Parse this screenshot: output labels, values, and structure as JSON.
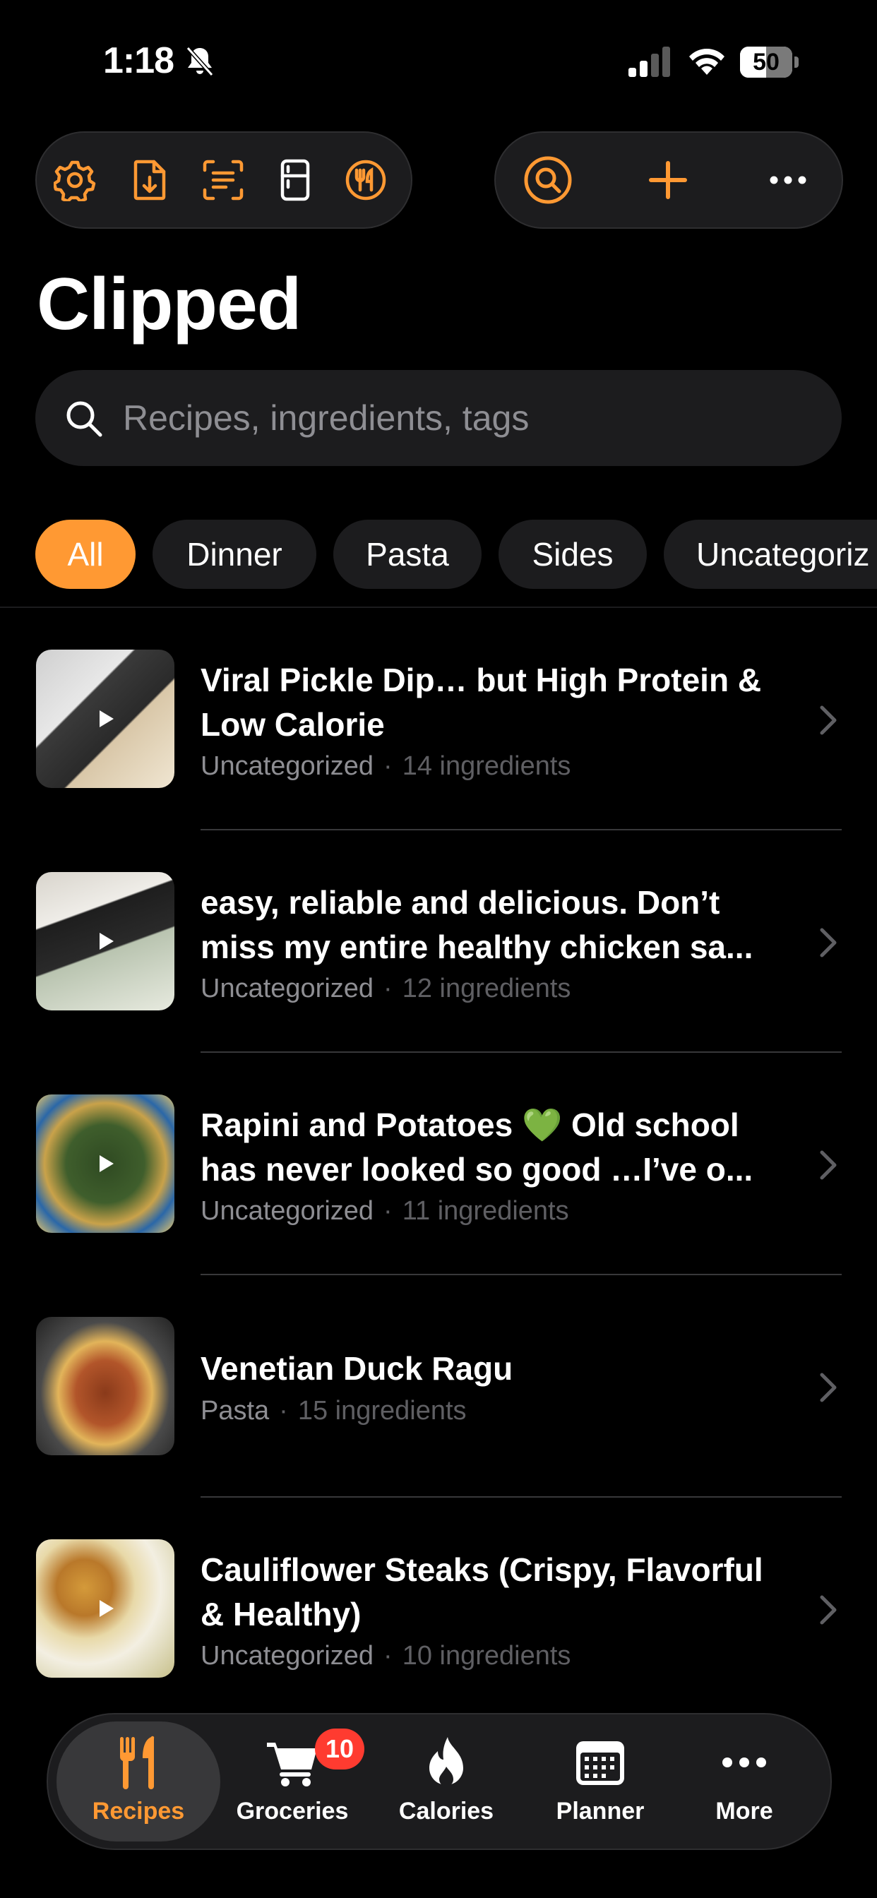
{
  "status_bar": {
    "time": "1:18",
    "battery": "50",
    "battery_level": 0.5,
    "icons": [
      "bell-slash-icon",
      "cellular-signal-icon",
      "wifi-icon",
      "battery-icon"
    ]
  },
  "toolbar_left": [
    "gear-icon",
    "document-download-icon",
    "scan-text-icon",
    "fridge-icon",
    "fork-knife-circle-icon"
  ],
  "toolbar_right": [
    "search-circle-icon",
    "plus-icon",
    "ellipsis-icon"
  ],
  "accent_color": "#ff9933",
  "page_title": "Clipped",
  "search": {
    "placeholder": "Recipes, ingredients, tags"
  },
  "filters": [
    {
      "label": "All",
      "active": true
    },
    {
      "label": "Dinner",
      "active": false
    },
    {
      "label": "Pasta",
      "active": false
    },
    {
      "label": "Sides",
      "active": false
    },
    {
      "label": "Uncategoriz",
      "active": false
    }
  ],
  "recipes": [
    {
      "title": "Viral Pickle Dip… but High Protein & Low Calorie",
      "category": "Uncategorized",
      "ingredients": "14 ingredients",
      "video": true
    },
    {
      "title": "easy, reliable and delicious. Don’t miss my entire healthy chicken sa...",
      "category": "Uncategorized",
      "ingredients": "12 ingredients",
      "video": true
    },
    {
      "title": "Rapini and Potatoes 💚  Old school has never looked so good …I’ve o...",
      "category": "Uncategorized",
      "ingredients": "11 ingredients",
      "video": true
    },
    {
      "title": "Venetian Duck Ragu",
      "category": "Pasta",
      "ingredients": "15 ingredients",
      "video": false
    },
    {
      "title": "Cauliflower Steaks (Crispy, Flavorful & Healthy)",
      "category": "Uncategorized",
      "ingredients": "10 ingredients",
      "video": true
    }
  ],
  "meta_separator": "·",
  "tabbar": {
    "tabs": [
      {
        "label": "Recipes",
        "icon": "fork-knife-icon",
        "active": true
      },
      {
        "label": "Groceries",
        "icon": "cart-icon",
        "active": false,
        "badge": "10"
      },
      {
        "label": "Calories",
        "icon": "flame-icon",
        "active": false
      },
      {
        "label": "Planner",
        "icon": "calendar-icon",
        "active": false
      },
      {
        "label": "More",
        "icon": "ellipsis-icon",
        "active": false
      }
    ]
  }
}
